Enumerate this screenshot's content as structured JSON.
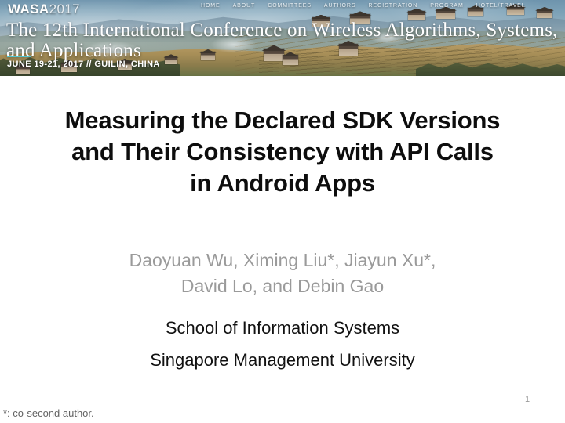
{
  "banner": {
    "logo_bold": "WASA",
    "logo_light": "2017",
    "nav": [
      {
        "label": "HOME"
      },
      {
        "label": "ABOUT"
      },
      {
        "label": "COMMITTEES"
      },
      {
        "label": "AUTHORS"
      },
      {
        "label": "REGISTRATION"
      },
      {
        "label": "PROGRAM"
      },
      {
        "label": "HOTEL/TRAVEL"
      }
    ],
    "conference_title": "The 12th International Conference on Wireless Algorithms, Systems, and Applications",
    "date_location": "JUNE 19-21, 2017 // GUILIN, CHINA",
    "accent_color": "#4fc4cf"
  },
  "slide": {
    "title": "Measuring the Declared SDK Versions and Their Consistency with API Calls in Android Apps",
    "title_lines": [
      "Measuring the Declared SDK Versions",
      "and Their Consistency with API Calls",
      "in Android Apps"
    ],
    "authors_lines": [
      "Daoyuan Wu, Ximing Liu*, Jiayun Xu*,",
      "David Lo, and Debin Gao"
    ],
    "affiliation_lines": [
      "School of Information Systems",
      "Singapore Management University"
    ],
    "footnote": "*: co-second author.",
    "slide_number": "1",
    "title_color": "#0d0d0d",
    "authors_color": "#9a9a9a",
    "affiliation_color": "#111111",
    "footnote_color": "#636363"
  }
}
